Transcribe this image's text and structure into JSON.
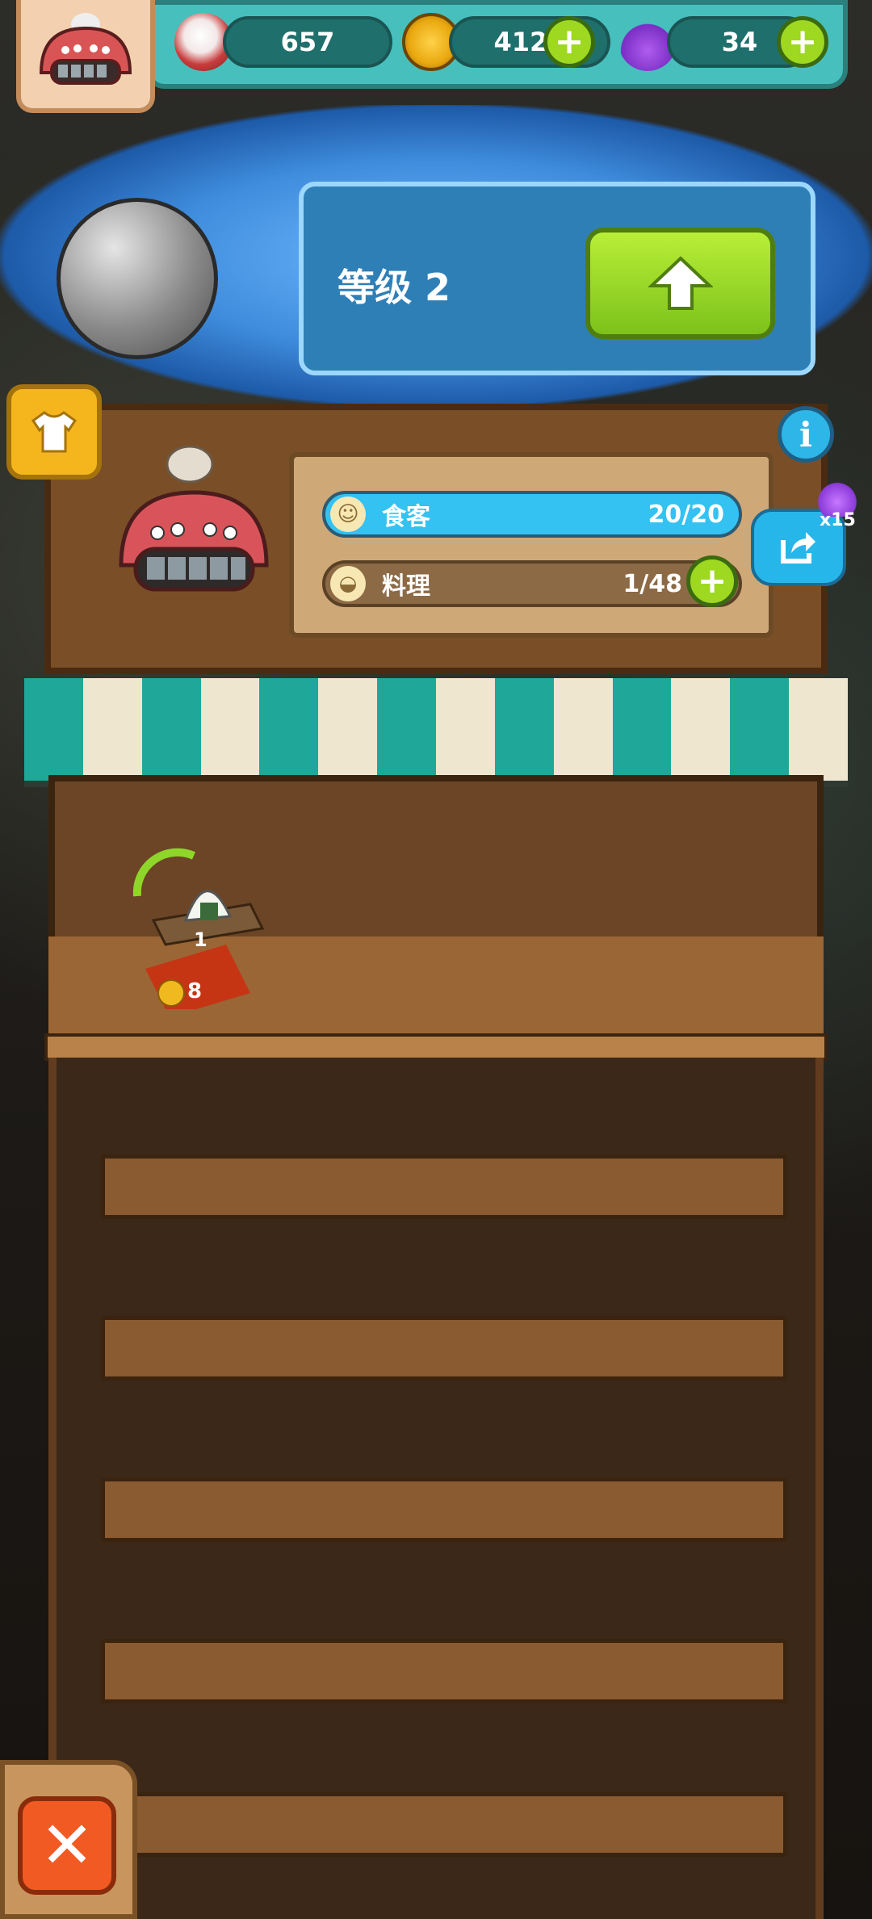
{
  "resources": {
    "eyeballs": "657",
    "coins": "4124",
    "potions": "34"
  },
  "level": {
    "label": "等级 2"
  },
  "shop": {
    "diners_label": "食客",
    "diners_value": "20/20",
    "dishes_label": "料理",
    "dishes_value": "1/48",
    "potion_bonus": "x15"
  },
  "item": {
    "count": "1",
    "price": "8"
  },
  "colors": {
    "accent_green": "#9ed821",
    "teal": "#47c0bd",
    "diners_bar": "#33c2f1",
    "close_red": "#f25a24"
  },
  "icons": [
    "eyeball-icon",
    "coin-icon",
    "potion-icon",
    "plus-icon",
    "arrow-up-icon",
    "info-icon",
    "share-icon",
    "shirt-icon",
    "person-icon",
    "bowl-icon",
    "close-icon"
  ]
}
